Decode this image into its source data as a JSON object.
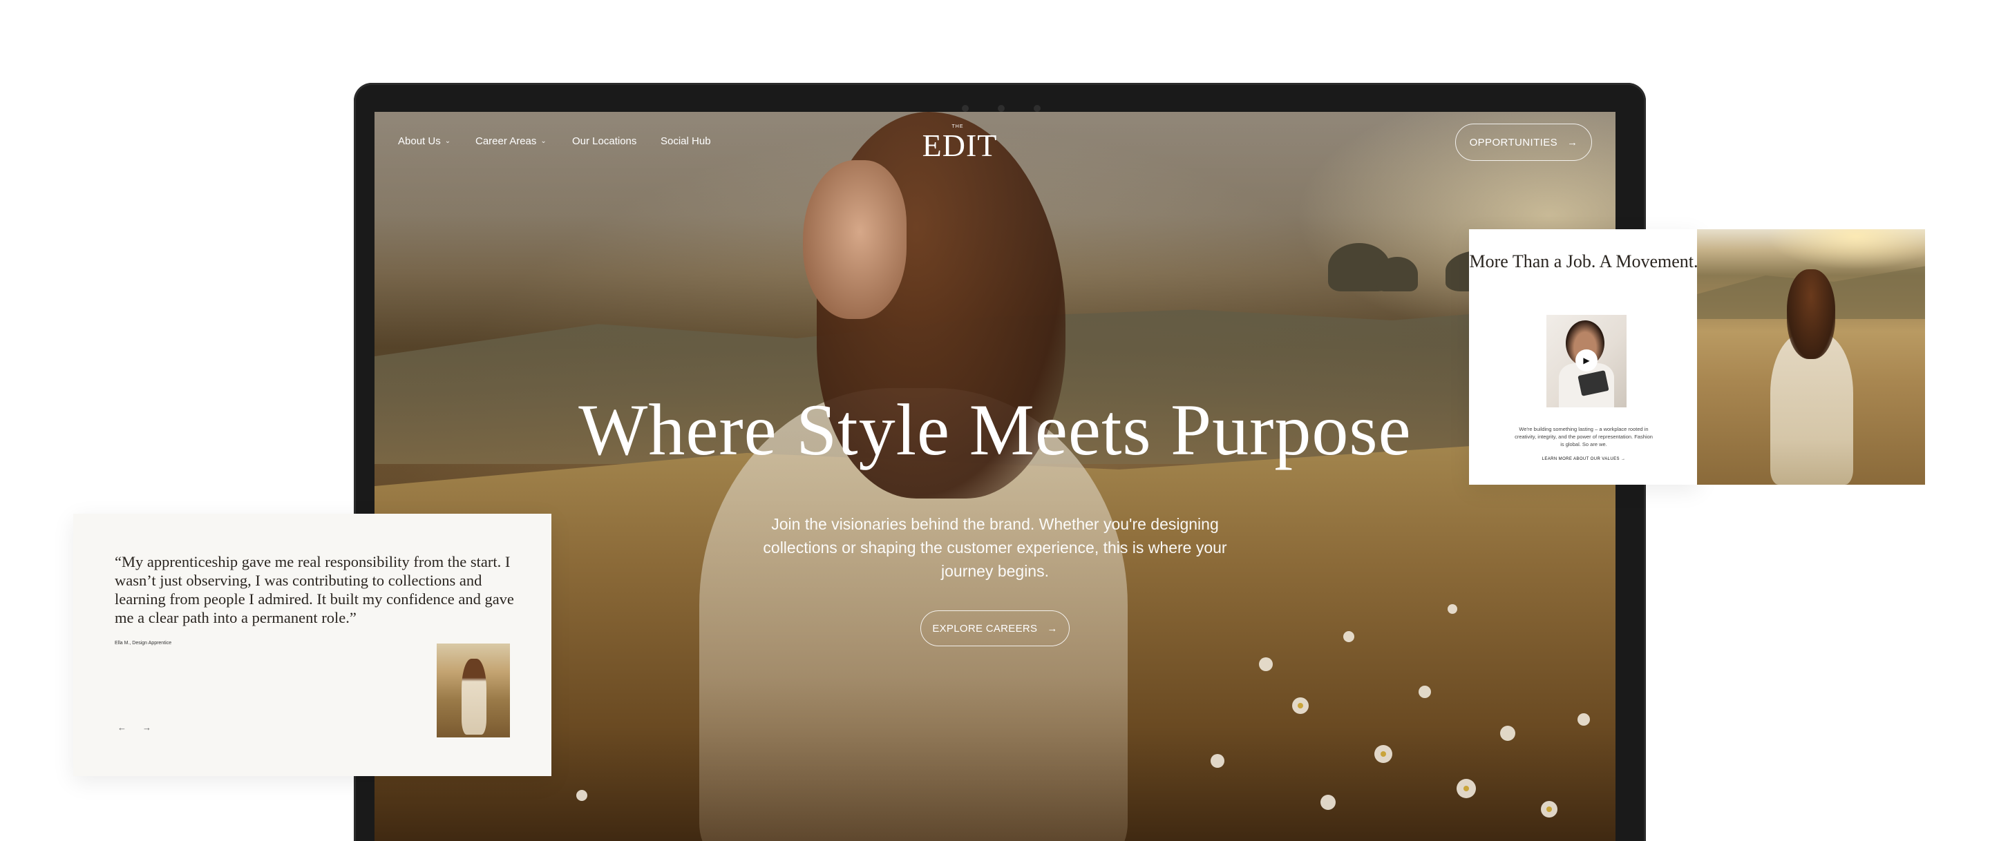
{
  "nav": {
    "items": [
      {
        "label": "About Us",
        "has_dropdown": true
      },
      {
        "label": "Career Areas",
        "has_dropdown": true
      },
      {
        "label": "Our Locations",
        "has_dropdown": false
      },
      {
        "label": "Social Hub",
        "has_dropdown": false
      }
    ],
    "logo_small": "THE",
    "logo": "EDIT",
    "cta_label": "OPPORTUNITIES",
    "cta_icon": "arrow-right-icon"
  },
  "hero": {
    "title": "Where Style Meets Purpose",
    "subtitle": "Join the visionaries behind the brand. Whether you're designing collections or shaping the customer experience, this is where your journey begins.",
    "cta_label": "EXPLORE CAREERS",
    "cta_icon": "arrow-right-icon"
  },
  "testimonial": {
    "quote": "“My apprenticeship gave me real responsibility from the start. I wasn’t just observing, I was contributing to collections and learning from people I admired. It built my confidence and gave me a clear path into a permanent role.”",
    "author": "Ella M., Design Apprentice",
    "prev_icon": "arrow-left-icon",
    "next_icon": "arrow-right-icon"
  },
  "movement_card": {
    "title": "More Than a Job. A Movement.",
    "body": "We're building something lasting – a workplace rooted in creativity, integrity, and the power of representation. Fashion is global. So are we.",
    "link_label": "LEARN MORE ABOUT OUR VALUES",
    "link_icon": "arrow-right-icon",
    "video_icon": "play-icon"
  },
  "colors": {
    "frame": "#1a1a1a",
    "card_bg": "#f8f7f4",
    "text_dark": "#2a2520",
    "white": "#ffffff"
  }
}
